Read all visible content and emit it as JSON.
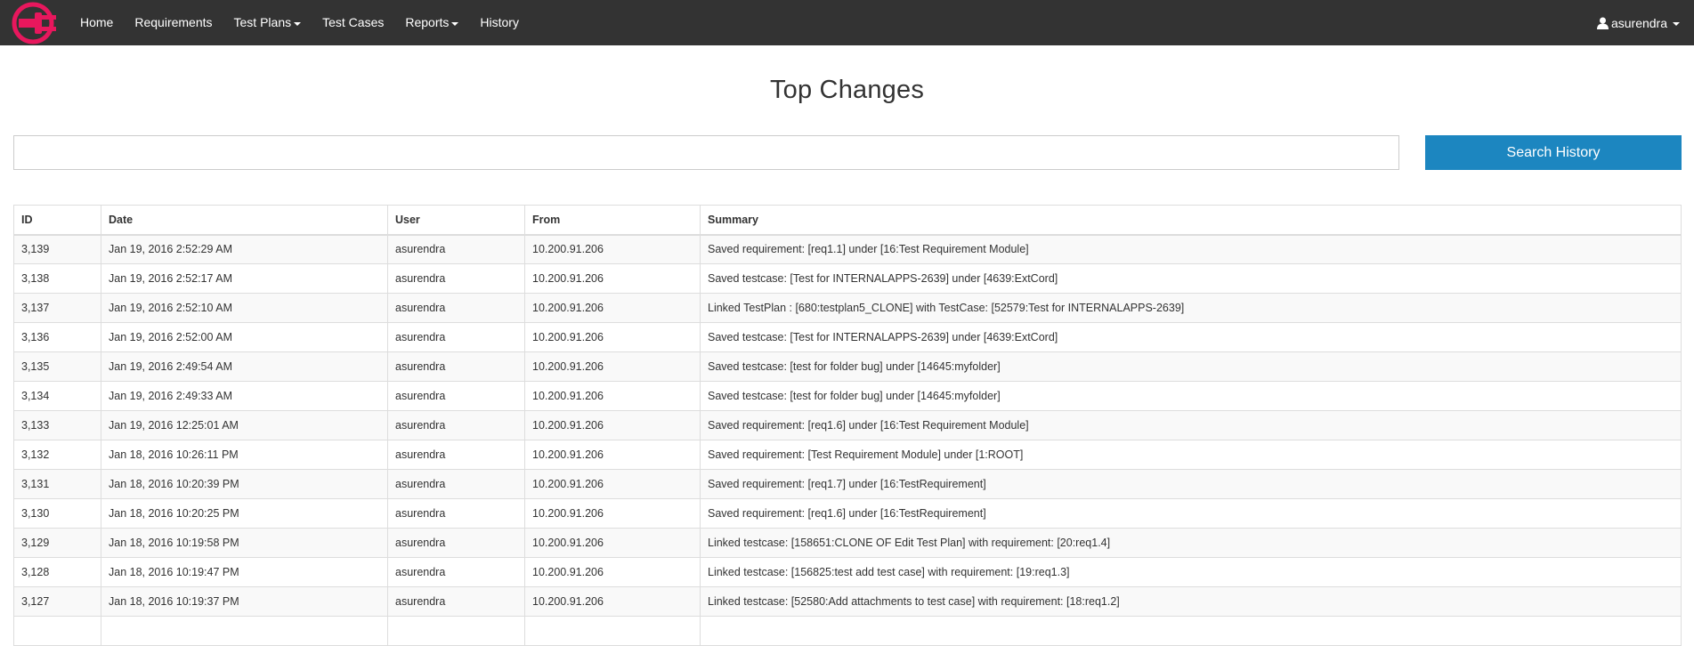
{
  "colors": {
    "navbar_bg": "#333333",
    "logo_accent": "#e8175d",
    "primary_button": "#1c86c0",
    "row_stripe": "#f9f9f9"
  },
  "navbar": {
    "logo_icon": "plug-logo-icon",
    "items": [
      {
        "label": "Home",
        "dropdown": false
      },
      {
        "label": "Requirements",
        "dropdown": false
      },
      {
        "label": "Test Plans",
        "dropdown": true
      },
      {
        "label": "Test Cases",
        "dropdown": false
      },
      {
        "label": "Reports",
        "dropdown": true
      },
      {
        "label": "History",
        "dropdown": false
      }
    ],
    "user": {
      "icon": "user-icon",
      "name": "asurendra"
    }
  },
  "page": {
    "title": "Top Changes"
  },
  "search": {
    "value": "",
    "placeholder": "",
    "button_label": "Search History"
  },
  "table": {
    "columns": [
      "ID",
      "Date",
      "User",
      "From",
      "Summary"
    ],
    "rows": [
      [
        "3,139",
        "Jan 19, 2016 2:52:29 AM",
        "asurendra",
        "10.200.91.206",
        "Saved requirement: [req1.1] under [16:Test Requirement Module]"
      ],
      [
        "3,138",
        "Jan 19, 2016 2:52:17 AM",
        "asurendra",
        "10.200.91.206",
        "Saved testcase: [Test for INTERNALAPPS-2639] under [4639:ExtCord]"
      ],
      [
        "3,137",
        "Jan 19, 2016 2:52:10 AM",
        "asurendra",
        "10.200.91.206",
        "Linked TestPlan : [680:testplan5_CLONE] with TestCase: [52579:Test for INTERNALAPPS-2639]"
      ],
      [
        "3,136",
        "Jan 19, 2016 2:52:00 AM",
        "asurendra",
        "10.200.91.206",
        "Saved testcase: [Test for INTERNALAPPS-2639] under [4639:ExtCord]"
      ],
      [
        "3,135",
        "Jan 19, 2016 2:49:54 AM",
        "asurendra",
        "10.200.91.206",
        "Saved testcase: [test for folder bug] under [14645:myfolder]"
      ],
      [
        "3,134",
        "Jan 19, 2016 2:49:33 AM",
        "asurendra",
        "10.200.91.206",
        "Saved testcase: [test for folder bug] under [14645:myfolder]"
      ],
      [
        "3,133",
        "Jan 19, 2016 12:25:01 AM",
        "asurendra",
        "10.200.91.206",
        "Saved requirement: [req1.6] under [16:Test Requirement Module]"
      ],
      [
        "3,132",
        "Jan 18, 2016 10:26:11 PM",
        "asurendra",
        "10.200.91.206",
        "Saved requirement: [Test Requirement Module] under [1:ROOT]"
      ],
      [
        "3,131",
        "Jan 18, 2016 10:20:39 PM",
        "asurendra",
        "10.200.91.206",
        "Saved requirement: [req1.7] under [16:TestRequirement]"
      ],
      [
        "3,130",
        "Jan 18, 2016 10:20:25 PM",
        "asurendra",
        "10.200.91.206",
        "Saved requirement: [req1.6] under [16:TestRequirement]"
      ],
      [
        "3,129",
        "Jan 18, 2016 10:19:58 PM",
        "asurendra",
        "10.200.91.206",
        "Linked testcase: [158651:CLONE OF Edit Test Plan] with requirement: [20:req1.4]"
      ],
      [
        "3,128",
        "Jan 18, 2016 10:19:47 PM",
        "asurendra",
        "10.200.91.206",
        "Linked testcase: [156825:test add test case] with requirement: [19:req1.3]"
      ],
      [
        "3,127",
        "Jan 18, 2016 10:19:37 PM",
        "asurendra",
        "10.200.91.206",
        "Linked testcase: [52580:Add attachments to test case] with requirement: [18:req1.2]"
      ],
      [
        "",
        "",
        "",
        "",
        ""
      ]
    ]
  }
}
